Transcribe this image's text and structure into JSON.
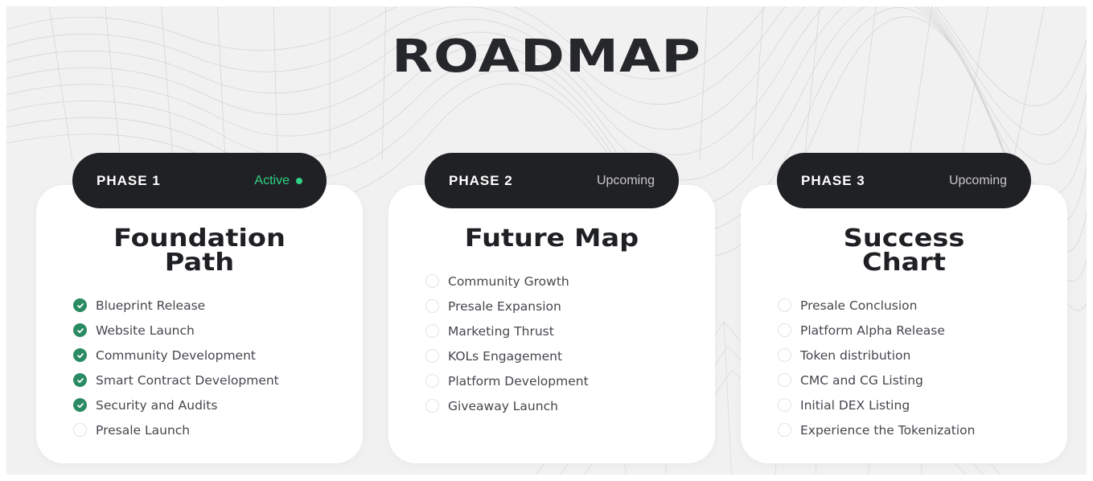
{
  "header": {
    "title": "ROADMAP"
  },
  "colors": {
    "background": "#f1f1f1",
    "card": "#ffffff",
    "pill": "#202124",
    "active": "#2fd285",
    "check_done": "#2a8a62",
    "title_text": "#26272b"
  },
  "phases": [
    {
      "label": "PHASE 1",
      "status": "Active",
      "active": true,
      "title_line1": "Foundation",
      "title_line2": "Path",
      "items": [
        {
          "label": "Blueprint Release",
          "done": true,
          "icon": "check-circle-icon"
        },
        {
          "label": "Website Launch",
          "done": true,
          "icon": "check-circle-icon"
        },
        {
          "label": "Community Development",
          "done": true,
          "icon": "check-circle-icon"
        },
        {
          "label": "Smart Contract Development",
          "done": true,
          "icon": "check-circle-icon"
        },
        {
          "label": "Security and Audits",
          "done": true,
          "icon": "check-circle-icon"
        },
        {
          "label": "Presale Launch",
          "done": false,
          "icon": "empty-circle-icon"
        }
      ]
    },
    {
      "label": "PHASE 2",
      "status": "Upcoming",
      "active": false,
      "title_line1": "Future Map",
      "title_line2": "",
      "items": [
        {
          "label": "Community Growth",
          "done": false,
          "icon": "empty-circle-icon"
        },
        {
          "label": "Presale Expansion",
          "done": false,
          "icon": "empty-circle-icon"
        },
        {
          "label": "Marketing Thrust",
          "done": false,
          "icon": "empty-circle-icon"
        },
        {
          "label": "KOLs Engagement",
          "done": false,
          "icon": "empty-circle-icon"
        },
        {
          "label": "Platform Development",
          "done": false,
          "icon": "empty-circle-icon"
        },
        {
          "label": "Giveaway Launch",
          "done": false,
          "icon": "empty-circle-icon"
        }
      ]
    },
    {
      "label": "PHASE 3",
      "status": "Upcoming",
      "active": false,
      "title_line1": "Success",
      "title_line2": "Chart",
      "items": [
        {
          "label": "Presale Conclusion",
          "done": false,
          "icon": "empty-circle-icon"
        },
        {
          "label": "Platform Alpha Release",
          "done": false,
          "icon": "empty-circle-icon"
        },
        {
          "label": "Token distribution",
          "done": false,
          "icon": "empty-circle-icon"
        },
        {
          "label": "CMC and CG Listing",
          "done": false,
          "icon": "empty-circle-icon"
        },
        {
          "label": "Initial DEX Listing",
          "done": false,
          "icon": "empty-circle-icon"
        },
        {
          "label": "Experience the Tokenization",
          "done": false,
          "icon": "empty-circle-icon"
        }
      ]
    }
  ]
}
